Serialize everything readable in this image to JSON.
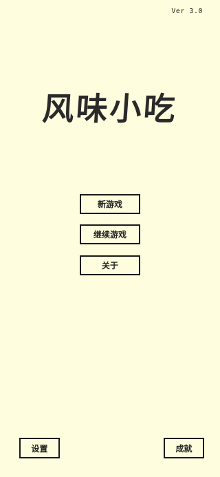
{
  "version": "Ver 3.0",
  "title": "风味小吃",
  "menu": {
    "new_game": "新游戏",
    "continue_game": "继续游戏",
    "about": "关于"
  },
  "footer": {
    "settings": "设置",
    "achievements": "成就"
  },
  "colors": {
    "background": "#fefede",
    "text": "#222222",
    "border": "#1a1a1a"
  }
}
